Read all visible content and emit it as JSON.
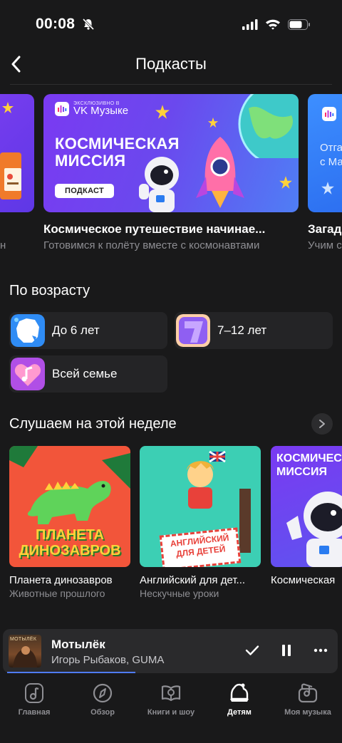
{
  "status": {
    "time": "00:08"
  },
  "header": {
    "title": "Подкасты"
  },
  "banners": [
    {
      "title": "",
      "subtitle": "н"
    },
    {
      "exclusive_small": "ЭКСКЛЮЗИВНО В",
      "exclusive_brand": "VK Музыке",
      "headline_1": "КОСМИЧЕСКАЯ",
      "headline_2": "МИССИЯ",
      "tag": "ПОДКАСТ",
      "title": "Космическое путешествие начинае...",
      "subtitle": "Готовимся к полёту вместе с космонавтами"
    },
    {
      "teaser_1": "Отга",
      "teaser_2": "с Ма",
      "title": "Загад",
      "subtitle": "Учим с"
    }
  ],
  "by_age": {
    "title": "По возрасту",
    "items": [
      {
        "label": "До 6 лет"
      },
      {
        "label": "7–12 лет"
      },
      {
        "label": "Всей семье"
      }
    ]
  },
  "weekly": {
    "title": "Слушаем на этой неделе",
    "cards": [
      {
        "title": "Планета динозавров",
        "subtitle": "Животные прошлого",
        "art_1": "ПЛАНЕТА",
        "art_2": "ДИНОЗАВРОВ"
      },
      {
        "title": "Английский для дет...",
        "subtitle": "Нескучные уроки",
        "art_1": "АНГЛИЙСКИЙ",
        "art_2": "ДЛЯ ДЕТЕЙ"
      },
      {
        "title": "Космическая",
        "subtitle": "",
        "art_1": "КОСМИЧЕС",
        "art_2": "МИССИЯ"
      }
    ]
  },
  "player": {
    "cover_text": "МОТЫЛЁК",
    "title": "Мотылёк",
    "artist": "Игорь Рыбаков, GUMA"
  },
  "tabs": [
    {
      "label": "Главная",
      "icon": "music-note-icon"
    },
    {
      "label": "Обзор",
      "icon": "compass-icon"
    },
    {
      "label": "Книги и шоу",
      "icon": "book-icon"
    },
    {
      "label": "Детям",
      "icon": "kids-hat-icon"
    },
    {
      "label": "Моя музыка",
      "icon": "my-music-icon"
    }
  ]
}
